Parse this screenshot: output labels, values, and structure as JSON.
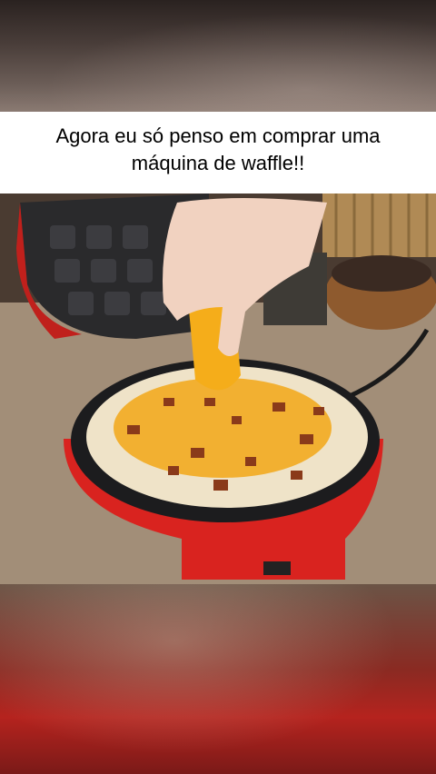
{
  "caption": {
    "line1": "Agora eu só penso em comprar uma",
    "line2": "máquina de waffle!!"
  },
  "scene": {
    "description_icon": "photo-waffle-maker-cheese",
    "colors": {
      "maker_red": "#d9231f",
      "counter": "#a28e78",
      "dough": "#efe3c8",
      "cheese": "#f2a716",
      "bacon": "#8a3a1a"
    }
  }
}
